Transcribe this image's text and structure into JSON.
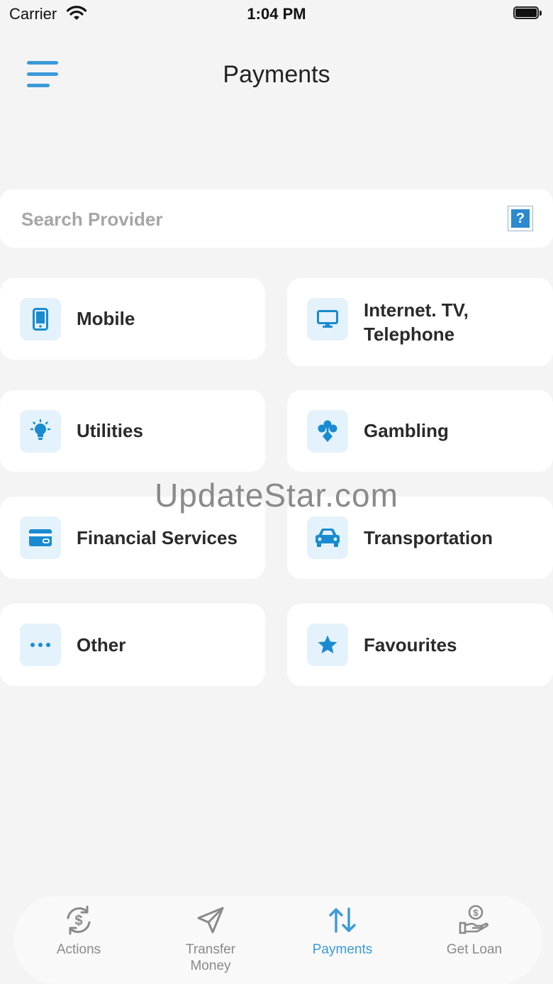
{
  "status_bar": {
    "carrier": "Carrier",
    "time": "1:04 PM"
  },
  "header": {
    "title": "Payments",
    "menu_icon": "hamburger-menu-icon"
  },
  "search": {
    "placeholder": "Search Provider",
    "value": "",
    "help_label": "?"
  },
  "categories": [
    {
      "label": "Mobile",
      "icon": "mobile-phone-icon"
    },
    {
      "label": "Internet. TV, Telephone",
      "line1": "Internet. TV,",
      "line2": "Telephone",
      "icon": "monitor-icon"
    },
    {
      "label": "Utilities",
      "icon": "lightbulb-icon"
    },
    {
      "label": "Gambling",
      "icon": "card-suits-icon"
    },
    {
      "label": "Financial Services",
      "icon": "credit-card-icon"
    },
    {
      "label": "Transportation",
      "icon": "car-icon"
    },
    {
      "label": "Other",
      "icon": "more-dots-icon"
    },
    {
      "label": "Favourites",
      "icon": "star-icon"
    }
  ],
  "watermark": "UpdateStar.com",
  "tab_bar": {
    "tabs": [
      {
        "label": "Actions",
        "icon": "dollar-refresh-icon"
      },
      {
        "label_line1": "Transfer",
        "label_line2": "Money",
        "icon": "paper-plane-icon"
      },
      {
        "label": "Payments",
        "icon": "up-down-arrows-icon",
        "active": true
      },
      {
        "label": "Get Loan",
        "icon": "hand-coin-icon"
      }
    ]
  },
  "colors": {
    "accent": "#3a9ad9",
    "icon_blue": "#1a8bd0",
    "icon_bg": "#e4f2fb",
    "background": "#f4f4f4"
  }
}
